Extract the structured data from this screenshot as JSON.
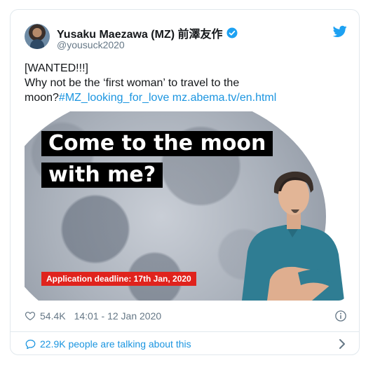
{
  "tweet": {
    "author": {
      "display_name": "Yusaku Maezawa (MZ) 前澤友作",
      "handle": "@yousuck2020"
    },
    "text": {
      "line1": "[WANTED!!!]",
      "line2": "Why not be the ‘first woman’ to travel to the",
      "line3_text": "moon?",
      "hashtag": "#MZ_looking_for_love",
      "url": "mz.abema.tv/en.html"
    },
    "media": {
      "headline_line1": "Come to the moon",
      "headline_line2": "with me?",
      "deadline": "Application deadline: 17th Jan, 2020"
    },
    "likes": "54.4K",
    "timestamp": "14:01 - 12 Jan 2020",
    "conversation": "22.9K people are talking about this"
  },
  "colors": {
    "link": "#1b95e0",
    "twitter_blue": "#1da1f2",
    "muted": "#657786",
    "deadline_red": "#e0231d"
  },
  "icons": [
    "verified-badge-icon",
    "twitter-bird-icon",
    "heart-icon",
    "info-icon",
    "chat-bubble-icon",
    "chevron-right-icon"
  ]
}
